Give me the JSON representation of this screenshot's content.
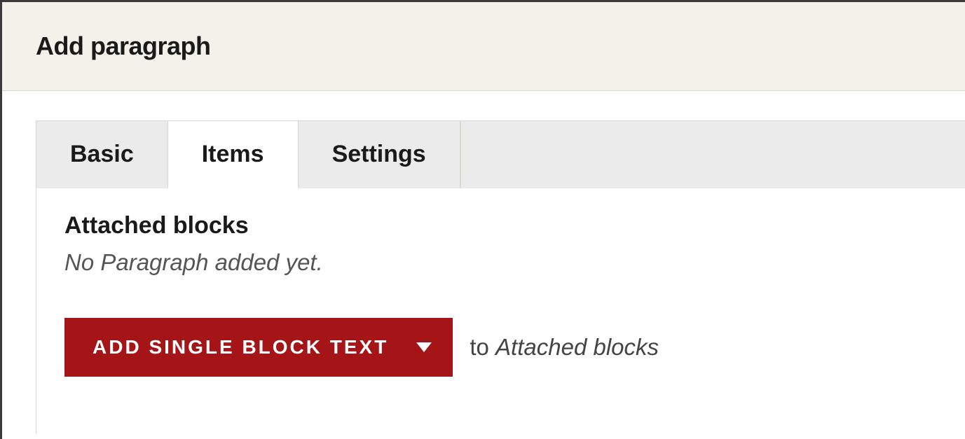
{
  "header": {
    "title": "Add paragraph"
  },
  "tabs": [
    {
      "label": "Basic",
      "active": false
    },
    {
      "label": "Items",
      "active": true
    },
    {
      "label": "Settings",
      "active": false
    }
  ],
  "section": {
    "heading": "Attached blocks",
    "empty_message": "No Paragraph added yet."
  },
  "action": {
    "button_label": "ADD SINGLE BLOCK TEXT",
    "suffix_prefix": "to ",
    "suffix_target": "Attached blocks"
  },
  "colors": {
    "primary": "#a51417",
    "header_bg": "#f2f1ea",
    "tab_inactive_bg": "#ebebeb",
    "border": "#d8d8d0"
  }
}
